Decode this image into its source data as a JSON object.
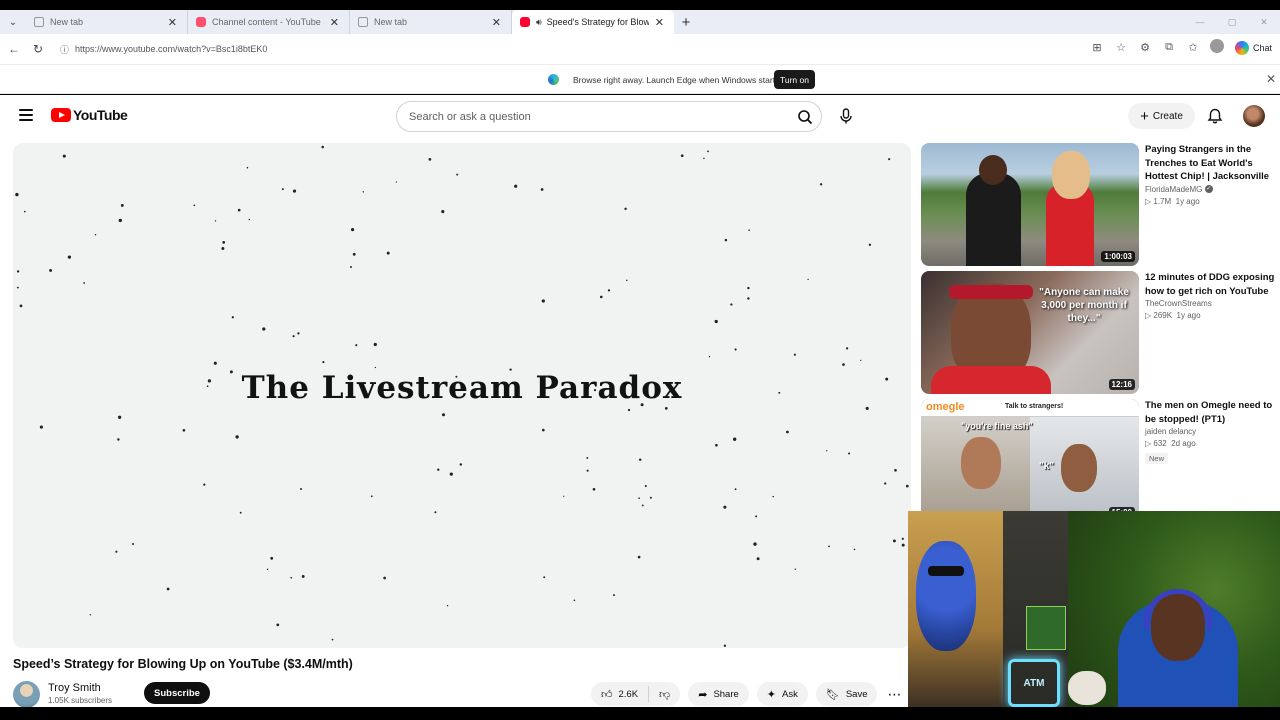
{
  "browser": {
    "tabs": [
      {
        "title": "New tab",
        "icon": "page-icon",
        "active": false
      },
      {
        "title": "Channel content - YouTube Studio",
        "icon": "youtube-studio-icon",
        "active": false
      },
      {
        "title": "New tab",
        "icon": "page-icon",
        "active": false
      },
      {
        "title": "Speed's Strategy for Blowing",
        "icon": "youtube-icon",
        "active": true,
        "audio": true
      }
    ],
    "url": "https://www.youtube.com/watch?v=Bsc1i8btEK0",
    "chat_label": "Chat"
  },
  "notification": {
    "message": "Browse right away. Launch Edge when Windows starts.",
    "button": "Turn on"
  },
  "youtube": {
    "logo_text": "YouTube",
    "search_placeholder": "Search or ask a question",
    "create_label": "Create",
    "video": {
      "overlay_title": "The Livestream Paradox",
      "title": "Speed’s Strategy for Blowing Up on YouTube ($3.4M/mth)",
      "channel": "Troy Smith",
      "subscribers": "1.05K subscribers",
      "subscribe_label": "Subscribe",
      "likes": "2.6K",
      "share_label": "Share",
      "ask_label": "Ask",
      "save_label": "Save"
    },
    "recommendations": [
      {
        "title": "Paying Strangers in the Trenches to Eat World's Hottest Chip! | Jacksonville",
        "channel": "FloridaMadeMG",
        "verified": true,
        "views": "1.7M",
        "age": "1y ago",
        "duration": "1:00:03"
      },
      {
        "title": "12 minutes of DDG exposing how to get rich on YouTube",
        "channel": "TheCrownStreams",
        "verified": false,
        "views": "269K",
        "age": "1y ago",
        "duration": "12:16",
        "thumb_text": "\"Anyone can make 3,000 per month if they...\""
      },
      {
        "title": "The men on Omegle need to be stopped! (PT1)",
        "channel": "jaiden delancy",
        "verified": false,
        "views": "632",
        "age": "2d ago",
        "duration": "15:00",
        "badge": "New",
        "thumb_brand": "omegle",
        "thumb_tagline": "Talk to strangers!",
        "thumb_caption1": "\"you're fine ash\"",
        "thumb_caption2": "\"k\""
      }
    ]
  },
  "webcam": {
    "neon_sign": "ATM"
  }
}
